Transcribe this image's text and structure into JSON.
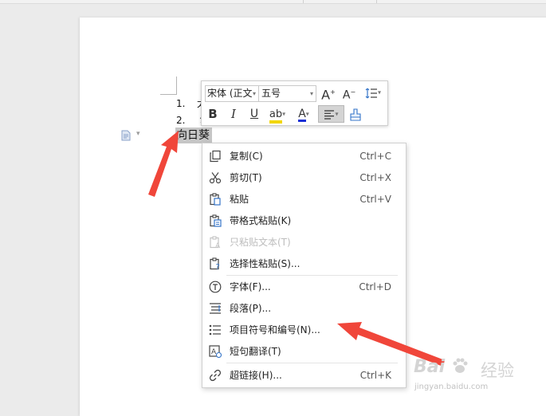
{
  "document": {
    "list_items": [
      {
        "number": "1.",
        "text": "太"
      },
      {
        "number": "2.",
        "text": "ゝ"
      }
    ],
    "selected_text": "向日葵"
  },
  "mini_toolbar": {
    "font_name": "宋体 (正文",
    "font_size": "五号",
    "grow_font": "A",
    "shrink_font": "A",
    "bold": "B",
    "italic": "I",
    "underline": "U",
    "highlight": "ab",
    "font_color": "A",
    "highlight_color": "#f2d600",
    "font_color_bar": "#1a2fd6"
  },
  "context_menu": {
    "items": [
      {
        "icon": "copy-icon",
        "label": "复制(C)",
        "shortcut": "Ctrl+C",
        "disabled": false
      },
      {
        "icon": "scissors-icon",
        "label": "剪切(T)",
        "shortcut": "Ctrl+X",
        "disabled": false
      },
      {
        "icon": "paste-icon",
        "label": "粘贴",
        "shortcut": "Ctrl+V",
        "disabled": false
      },
      {
        "icon": "paste-formatted-icon",
        "label": "带格式粘贴(K)",
        "shortcut": "",
        "disabled": false
      },
      {
        "icon": "paste-text-icon",
        "label": "只粘贴文本(T)",
        "shortcut": "",
        "disabled": true
      },
      {
        "icon": "paste-special-icon",
        "label": "选择性粘贴(S)...",
        "shortcut": "",
        "disabled": false
      },
      {
        "icon": "font-icon",
        "label": "字体(F)...",
        "shortcut": "Ctrl+D",
        "disabled": false
      },
      {
        "icon": "paragraph-icon",
        "label": "段落(P)...",
        "shortcut": "",
        "disabled": false
      },
      {
        "icon": "bullets-icon",
        "label": "项目符号和编号(N)...",
        "shortcut": "",
        "disabled": false
      },
      {
        "icon": "translate-icon",
        "label": "短句翻译(T)",
        "shortcut": "",
        "disabled": false
      },
      {
        "icon": "hyperlink-icon",
        "label": "超链接(H)...",
        "shortcut": "Ctrl+K",
        "disabled": false
      }
    ]
  },
  "watermark": {
    "brand": "Bai",
    "brand_suffix": "经验",
    "url": "jingyan.baidu.com"
  },
  "annotation_color": "#f0463a"
}
